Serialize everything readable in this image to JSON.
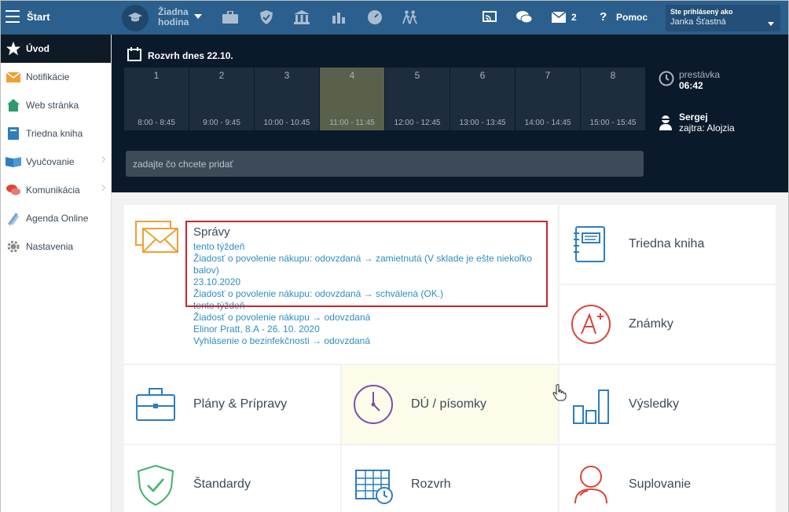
{
  "topbar": {
    "brand": "Štart",
    "lesson_line1": "Žiadna",
    "lesson_line2": "hodina",
    "messages_count": "2",
    "help_label": "Pomoc",
    "user_line1": "Ste prihlásený ako",
    "user_line2": "Janka Šťastná"
  },
  "sidebar": {
    "items": [
      {
        "label": "Úvod"
      },
      {
        "label": "Notifikácie"
      },
      {
        "label": "Web stránka"
      },
      {
        "label": "Triedna kniha"
      },
      {
        "label": "Vyučovanie"
      },
      {
        "label": "Komunikácia"
      },
      {
        "label": "Agenda Online"
      },
      {
        "label": "Nastavenia"
      }
    ]
  },
  "schedule": {
    "title": "Rozvrh dnes 22.10.",
    "periods": [
      {
        "num": "1",
        "time": "8:00 - 8:45"
      },
      {
        "num": "2",
        "time": "9:00 - 9:45"
      },
      {
        "num": "3",
        "time": "10:00 - 10:45"
      },
      {
        "num": "4",
        "time": "11:00 - 11:45"
      },
      {
        "num": "5",
        "time": "12:00 - 12:45"
      },
      {
        "num": "6",
        "time": "13:00 - 13:45"
      },
      {
        "num": "7",
        "time": "14:00 - 14:45"
      },
      {
        "num": "8",
        "time": "15:00 - 15:45"
      }
    ],
    "break_label": "prestávka",
    "break_time": "06:42",
    "sub_name": "Sergej",
    "sub_info": "zajtra: Alojzia",
    "add_placeholder": "zadajte čo chcete pridať"
  },
  "messages": {
    "title": "Správy",
    "lines": [
      "tento týždeň",
      "Žiadosť o povolenie nákupu: odovzdaná → zamietnutá (V sklade je ešte niekoľko balov)",
      "23.10.2020",
      "Žiadosť o povolenie nákupu: odovzdaná → schválená (OK.)",
      "tento týždeň",
      "Žiadosť o povolenie nákupu → odovzdaná",
      "Elinor Pratt, 8.A - 26. 10. 2020",
      "Vyhlásenie o bezinfekčnosti → odovzdaná"
    ]
  },
  "tiles": {
    "triedna": "Triedna kniha",
    "znamky": "Známky",
    "plany": "Plány & Prípravy",
    "du": "DÚ / písomky",
    "vysledky": "Výsledky",
    "standardy": "Štandardy",
    "rozvrh": "Rozvrh",
    "suplovanie": "Suplovanie"
  },
  "colors": {
    "topbar": "#2b5f8d",
    "dark_panel": "#0b1a2a",
    "current_period": "#59604b",
    "link_blue": "#2f8ec1",
    "highlight_red": "#c8262c",
    "icon_orange": "#f0a030",
    "icon_blue": "#2e7dbd",
    "icon_red": "#d9463b",
    "icon_purple": "#7a4fae",
    "icon_green": "#3fb36a"
  }
}
